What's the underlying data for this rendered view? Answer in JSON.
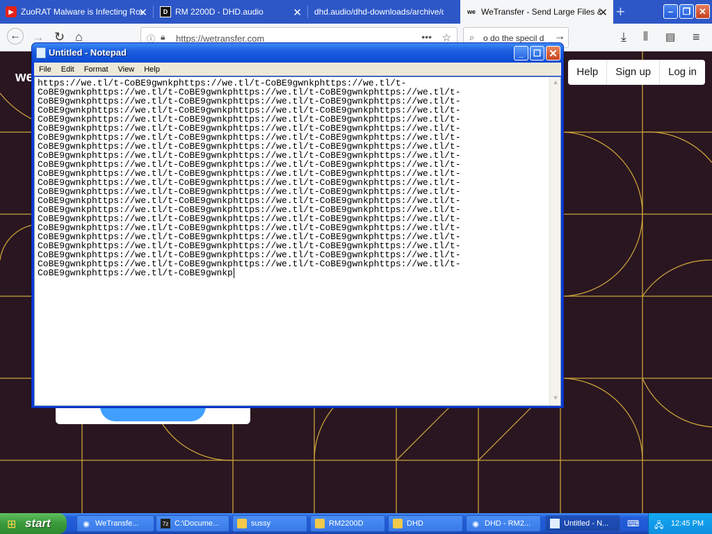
{
  "browser": {
    "tabs": [
      {
        "title": "ZuoRAT Malware is Infecting Rou",
        "icon": "youtube-icon",
        "active": false
      },
      {
        "title": "RM 2200D - DHD.audio",
        "icon": "dhd-icon",
        "active": false
      },
      {
        "title": "dhd.audio/dhd-downloads/archive/dh",
        "icon": "",
        "active": false
      },
      {
        "title": "WeTransfer - Send Large Files & S",
        "icon": "wetransfer-icon",
        "active": true
      }
    ],
    "url": "https://wetransfer.com",
    "search_value": "o do the specil d"
  },
  "site": {
    "logo": "we",
    "nav": [
      "Help",
      "Sign up",
      "Log in"
    ]
  },
  "notepad": {
    "title": "Untitled - Notepad",
    "menu": [
      "File",
      "Edit",
      "Format",
      "View",
      "Help"
    ],
    "lines": [
      "https://we.tl/t-CoBE9gwnkphttps://we.tl/t-CoBE9gwnkphttps://we.tl/t-",
      "CoBE9gwnkphttps://we.tl/t-CoBE9gwnkphttps://we.tl/t-CoBE9gwnkphttps://we.tl/t-",
      "CoBE9gwnkphttps://we.tl/t-CoBE9gwnkphttps://we.tl/t-CoBE9gwnkphttps://we.tl/t-",
      "CoBE9gwnkphttps://we.tl/t-CoBE9gwnkphttps://we.tl/t-CoBE9gwnkphttps://we.tl/t-",
      "CoBE9gwnkphttps://we.tl/t-CoBE9gwnkphttps://we.tl/t-CoBE9gwnkphttps://we.tl/t-",
      "CoBE9gwnkphttps://we.tl/t-CoBE9gwnkphttps://we.tl/t-CoBE9gwnkphttps://we.tl/t-",
      "CoBE9gwnkphttps://we.tl/t-CoBE9gwnkphttps://we.tl/t-CoBE9gwnkphttps://we.tl/t-",
      "CoBE9gwnkphttps://we.tl/t-CoBE9gwnkphttps://we.tl/t-CoBE9gwnkphttps://we.tl/t-",
      "CoBE9gwnkphttps://we.tl/t-CoBE9gwnkphttps://we.tl/t-CoBE9gwnkphttps://we.tl/t-",
      "CoBE9gwnkphttps://we.tl/t-CoBE9gwnkphttps://we.tl/t-CoBE9gwnkphttps://we.tl/t-",
      "CoBE9gwnkphttps://we.tl/t-CoBE9gwnkphttps://we.tl/t-CoBE9gwnkphttps://we.tl/t-",
      "CoBE9gwnkphttps://we.tl/t-CoBE9gwnkphttps://we.tl/t-CoBE9gwnkphttps://we.tl/t-",
      "CoBE9gwnkphttps://we.tl/t-CoBE9gwnkphttps://we.tl/t-CoBE9gwnkphttps://we.tl/t-",
      "CoBE9gwnkphttps://we.tl/t-CoBE9gwnkphttps://we.tl/t-CoBE9gwnkphttps://we.tl/t-",
      "CoBE9gwnkphttps://we.tl/t-CoBE9gwnkphttps://we.tl/t-CoBE9gwnkphttps://we.tl/t-",
      "CoBE9gwnkphttps://we.tl/t-CoBE9gwnkphttps://we.tl/t-CoBE9gwnkphttps://we.tl/t-",
      "CoBE9gwnkphttps://we.tl/t-CoBE9gwnkphttps://we.tl/t-CoBE9gwnkphttps://we.tl/t-",
      "CoBE9gwnkphttps://we.tl/t-CoBE9gwnkphttps://we.tl/t-CoBE9gwnkphttps://we.tl/t-",
      "CoBE9gwnkphttps://we.tl/t-CoBE9gwnkphttps://we.tl/t-CoBE9gwnkphttps://we.tl/t-",
      "CoBE9gwnkphttps://we.tl/t-CoBE9gwnkphttps://we.tl/t-CoBE9gwnkphttps://we.tl/t-",
      "CoBE9gwnkphttps://we.tl/t-CoBE9gwnkphttps://we.tl/t-CoBE9gwnkphttps://we.tl/t-",
      "CoBE9gwnkphttps://we.tl/t-CoBE9gwnkp"
    ]
  },
  "taskbar": {
    "start_label": "start",
    "items": [
      {
        "label": "WeTransfe...",
        "icon": "firefox-icon",
        "active": false
      },
      {
        "label": "C:\\Docume...",
        "icon": "7zip-icon",
        "active": false
      },
      {
        "label": "sussy",
        "icon": "folder-icon",
        "active": false
      },
      {
        "label": "RM2200D",
        "icon": "folder-icon",
        "active": false
      },
      {
        "label": "DHD",
        "icon": "folder-icon",
        "active": false
      },
      {
        "label": "DHD - RM2...",
        "icon": "firefox-icon",
        "active": false
      },
      {
        "label": "Untitled - N...",
        "icon": "notepad-icon",
        "active": true
      }
    ],
    "clock": "12:45 PM"
  },
  "colors": {
    "page_bg": "#2a1620",
    "grid_line": "#c9a23a",
    "xp_blue": "#245edb",
    "start_green": "#3a9a3a"
  }
}
